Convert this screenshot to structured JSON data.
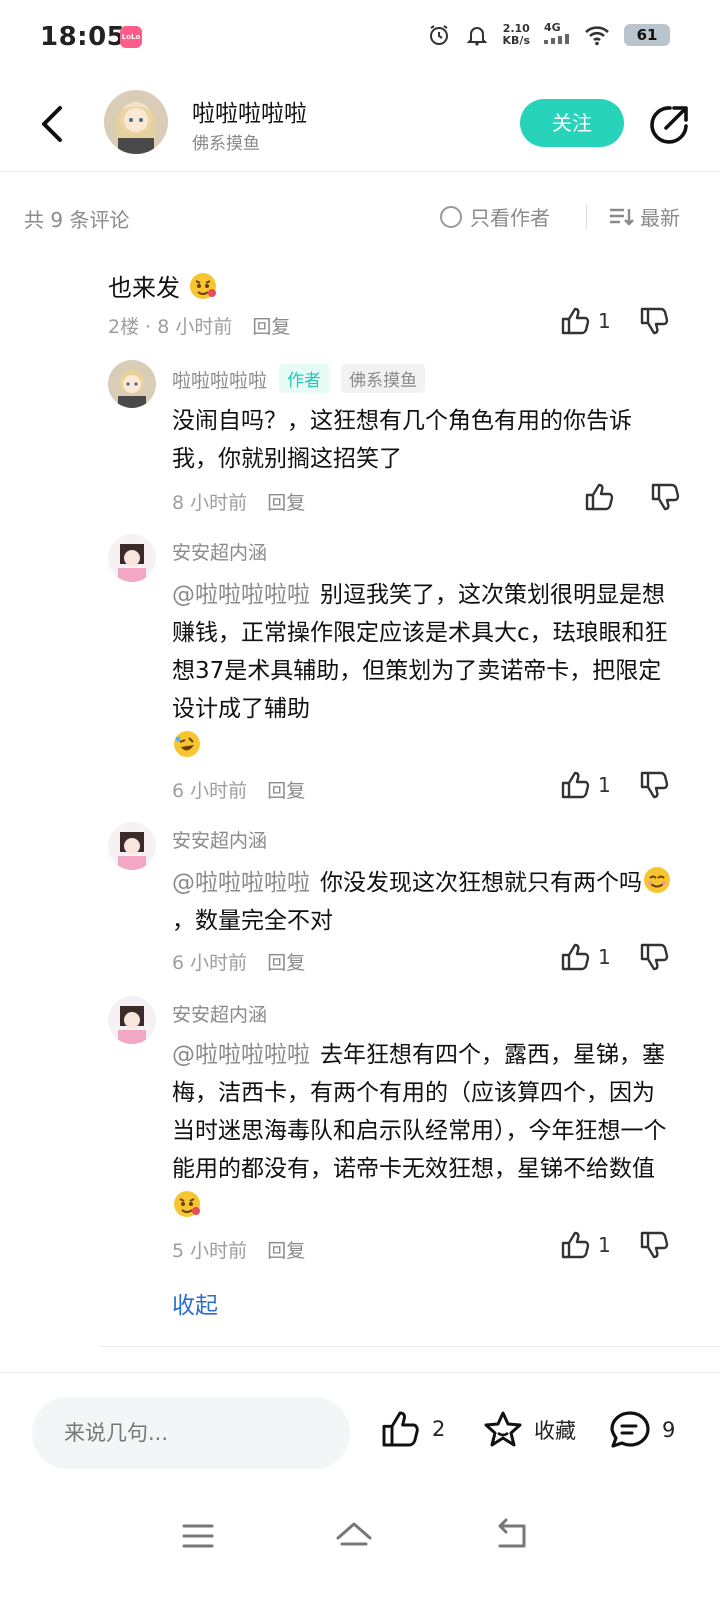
{
  "status": {
    "time": "18:05",
    "app_badge": "LoLo",
    "speed_value": "2.10",
    "speed_unit": "KB/s",
    "network": "4G",
    "battery": "61"
  },
  "header": {
    "username": "啦啦啦啦啦",
    "subtitle": "佛系摸鱼",
    "follow_label": "关注"
  },
  "summary": {
    "count_label": "共 9 条评论",
    "author_only_label": "只看作者",
    "sort_label": "最新"
  },
  "main_comment": {
    "text": "也来发",
    "floor": "2楼",
    "time": "8 小时前",
    "reply_label": "回复",
    "likes": "1"
  },
  "replies": [
    {
      "name": "啦啦啦啦啦",
      "author_tag": "作者",
      "title_tag": "佛系摸鱼",
      "mention": "",
      "text": "没闹自吗？，这狂想有几个角色有用的你告诉我，你就别搁这招笑了",
      "time": "8 小时前",
      "reply_label": "回复",
      "likes": ""
    },
    {
      "name": "安安超内涵",
      "mention": "@啦啦啦啦啦",
      "text": "别逗我笑了，这次策划很明显是想赚钱，正常操作限定应该是术具大c，珐琅眼和狂想37是术具辅助，但策划为了卖诺帝卡，把限定设计成了辅助",
      "time": "6 小时前",
      "reply_label": "回复",
      "likes": "1"
    },
    {
      "name": "安安超内涵",
      "mention": "@啦啦啦啦啦",
      "text_a": "你没发现这次狂想就只有两个吗",
      "text_b": "，数量完全不对",
      "time": "6 小时前",
      "reply_label": "回复",
      "likes": "1"
    },
    {
      "name": "安安超内涵",
      "mention": "@啦啦啦啦啦",
      "text": "去年狂想有四个，露西，星锑，塞梅，洁西卡，有两个有用的（应该算四个，因为当时迷思海毒队和启示队经常用），今年狂想一个能用的都没有，诺帝卡无效狂想，星锑不给数值",
      "time": "5 小时前",
      "reply_label": "回复",
      "likes": "1"
    }
  ],
  "collapse_label": "收起",
  "bottom": {
    "input_placeholder": "来说几句...",
    "like_count": "2",
    "favorite_label": "收藏",
    "comment_count": "9"
  },
  "colors": {
    "accent": "#27d3b9",
    "link": "#2b6dd6",
    "muted": "#8a8a8a"
  }
}
